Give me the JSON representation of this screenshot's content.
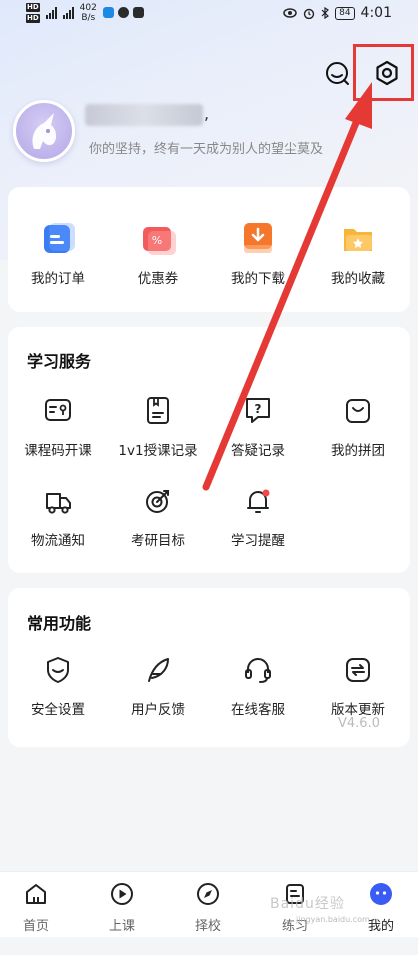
{
  "status_bar": {
    "hd1": "HD",
    "hd2": "HD",
    "net_speed": "402",
    "net_unit": "B/s",
    "battery": "84",
    "time": "4:01"
  },
  "header": {
    "message_icon": "chat-bubble-icon",
    "settings_icon": "gear-icon"
  },
  "profile": {
    "name_visible_tail": ",",
    "motto": "你的坚持，终有一天成为别人的望尘莫及"
  },
  "orders": {
    "items": [
      {
        "label": "我的订单",
        "icon": "order-list-icon",
        "color": "#3b7cf5"
      },
      {
        "label": "优惠券",
        "icon": "coupon-icon",
        "color": "#f25b5b"
      },
      {
        "label": "我的下载",
        "icon": "download-icon",
        "color": "#f5772c"
      },
      {
        "label": "我的收藏",
        "icon": "favorite-folder-icon",
        "color": "#f7b53a"
      }
    ]
  },
  "study": {
    "title": "学习服务",
    "items": [
      {
        "label": "课程码开课",
        "icon": "course-code-icon"
      },
      {
        "label": "1v1授课记录",
        "icon": "lesson-record-icon"
      },
      {
        "label": "答疑记录",
        "icon": "qa-record-icon"
      },
      {
        "label": "我的拼团",
        "icon": "group-buy-icon"
      },
      {
        "label": "物流通知",
        "icon": "delivery-truck-icon"
      },
      {
        "label": "考研目标",
        "icon": "target-icon"
      },
      {
        "label": "学习提醒",
        "icon": "bell-icon"
      }
    ]
  },
  "common": {
    "title": "常用功能",
    "items": [
      {
        "label": "安全设置",
        "icon": "shield-icon"
      },
      {
        "label": "用户反馈",
        "icon": "feather-icon"
      },
      {
        "label": "在线客服",
        "icon": "headset-icon"
      },
      {
        "label": "版本更新",
        "icon": "update-icon"
      }
    ],
    "version": "V4.6.0"
  },
  "bottom_nav": {
    "items": [
      {
        "label": "首页",
        "icon": "home-icon"
      },
      {
        "label": "上课",
        "icon": "play-icon"
      },
      {
        "label": "择校",
        "icon": "compass-icon"
      },
      {
        "label": "练习",
        "icon": "practice-icon"
      },
      {
        "label": "我的",
        "icon": "mascot-icon"
      }
    ],
    "watermark": "Baidu经验",
    "watermark_sub": "jingyan.baidu.com"
  },
  "colors": {
    "accent": "#3b7cf5",
    "annotation": "#e53935"
  }
}
